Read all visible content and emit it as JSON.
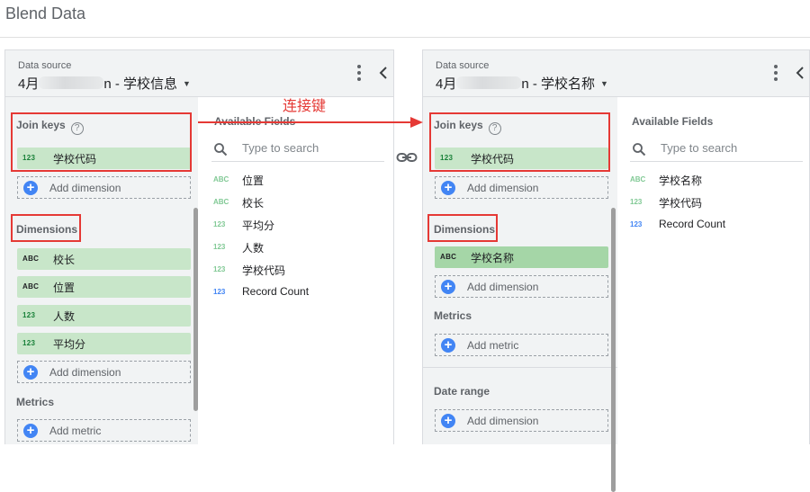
{
  "app": {
    "title": "Blend Data"
  },
  "annotation": {
    "text": "连接键"
  },
  "left_panel": {
    "ds_label": "Data source",
    "ds_name_prefix": "4月",
    "ds_name_suffix": "n - 学校信息",
    "join_keys_label": "Join keys",
    "join_keys": [
      {
        "type": "123",
        "label": "学校代码"
      }
    ],
    "add_dimension": "Add dimension",
    "dimensions_label": "Dimensions",
    "dimensions": [
      {
        "type": "ABC",
        "label": "校长"
      },
      {
        "type": "ABC",
        "label": "位置"
      },
      {
        "type": "123",
        "label": "人数"
      },
      {
        "type": "123",
        "label": "平均分"
      }
    ],
    "metrics_label": "Metrics",
    "add_metric": "Add metric",
    "available_fields_label": "Available Fields",
    "search_placeholder": "Type to search",
    "available_fields": [
      {
        "type": "ABC",
        "label": "位置"
      },
      {
        "type": "ABC",
        "label": "校长"
      },
      {
        "type": "123",
        "label": "平均分"
      },
      {
        "type": "123",
        "label": "人数"
      },
      {
        "type": "123",
        "label": "学校代码"
      },
      {
        "type": "123",
        "label": "Record Count"
      }
    ]
  },
  "right_panel": {
    "ds_label": "Data source",
    "ds_name_prefix": "4月",
    "ds_name_suffix": "n - 学校名称",
    "join_keys_label": "Join keys",
    "join_keys": [
      {
        "type": "123",
        "label": "学校代码"
      }
    ],
    "add_dimension": "Add dimension",
    "dimensions_label": "Dimensions",
    "dimensions": [
      {
        "type": "ABC",
        "label": "学校名称"
      }
    ],
    "metrics_label": "Metrics",
    "add_metric": "Add metric",
    "date_range_label": "Date range",
    "date_add_dimension": "Add dimension",
    "available_fields_label": "Available Fields",
    "search_placeholder": "Type to search",
    "available_fields": [
      {
        "type": "ABC",
        "label": "学校名称"
      },
      {
        "type": "123",
        "label": "学校代码"
      },
      {
        "type": "123",
        "label": "Record Count"
      }
    ]
  },
  "colors": {
    "chip_green": "#c8e6c9",
    "accent_blue": "#4285f4",
    "annotation_red": "#e53935"
  }
}
